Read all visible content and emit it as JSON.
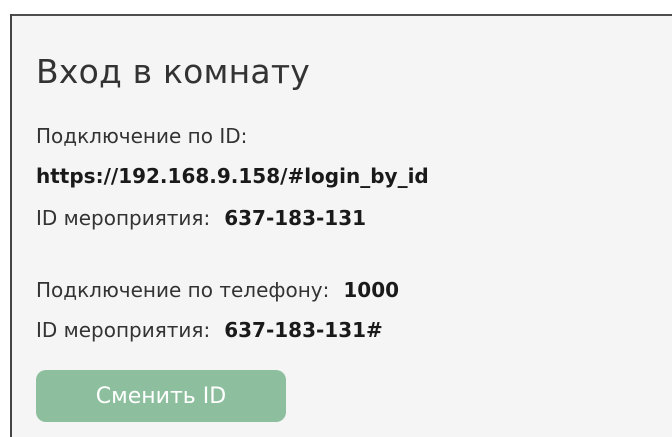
{
  "room": {
    "title": "Вход в комнату",
    "id_connect_label": "Подключение по ID:",
    "url": "https://192.168.9.158/#login_by_id",
    "event_id_label_1": "ID мероприятия:",
    "event_id_1": "637-183-131",
    "phone_connect_label": "Подключение по телефону:",
    "phone_number": "1000",
    "event_id_label_2": "ID мероприятия:",
    "event_id_2": "637-183-131#",
    "change_id_button": "Сменить ID"
  },
  "colors": {
    "button_bg": "#8dbf9e",
    "panel_bg": "#f5f5f5"
  }
}
